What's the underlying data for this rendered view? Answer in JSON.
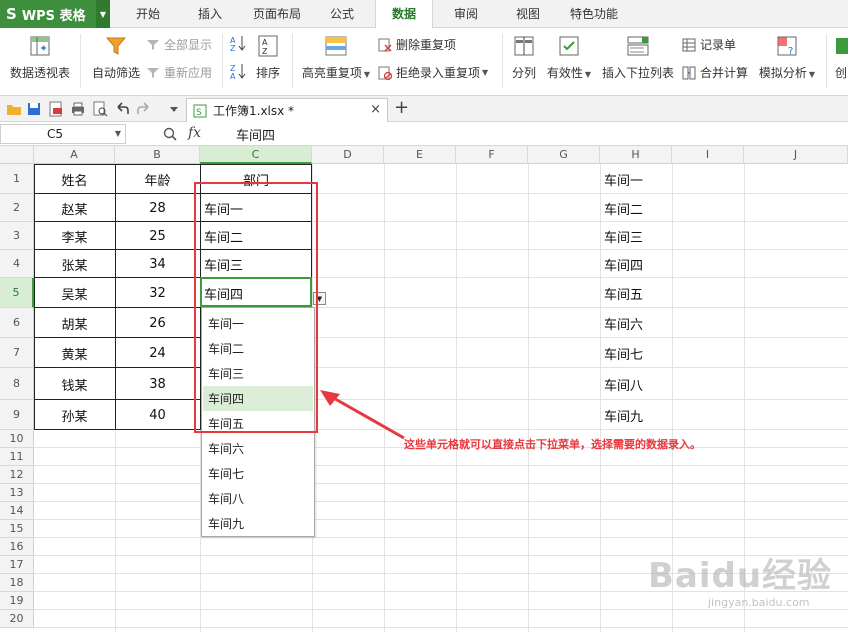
{
  "app": {
    "logo": "S",
    "name": "WPS 表格"
  },
  "tabs": [
    "开始",
    "插入",
    "页面布局",
    "公式",
    "数据",
    "审阅",
    "视图",
    "特色功能"
  ],
  "active_tab": "数据",
  "ribbon": {
    "pivot": "数据透视表",
    "autofilter": "自动筛选",
    "show_all": "全部显示",
    "reapply": "重新应用",
    "sort": "排序",
    "highlight_dup": "高亮重复项",
    "remove_dup": "删除重复项",
    "reject_dup": "拒绝录入重复项",
    "split": "分列",
    "validity": "有效性",
    "insert_dropdown": "插入下拉列表",
    "record": "记录单",
    "merge_calc": "合并计算",
    "simulate": "模拟分析",
    "create": "创"
  },
  "doc": {
    "tab_label": "工作簿1.xlsx *",
    "close": "×",
    "new_tab": "+"
  },
  "formula_bar": {
    "name_box": "C5",
    "fx": "fx",
    "value": "车间四"
  },
  "sheet": {
    "columns": [
      "A",
      "B",
      "C",
      "D",
      "E",
      "F",
      "G",
      "H",
      "I",
      "J"
    ],
    "rows": [
      "1",
      "2",
      "3",
      "4",
      "5",
      "6",
      "7",
      "8",
      "9",
      "10",
      "11",
      "12",
      "13",
      "14",
      "15",
      "16",
      "17",
      "18",
      "19",
      "20"
    ],
    "selected_column": "C",
    "selected_row": "5",
    "header_row": {
      "name": "姓名",
      "age": "年龄",
      "dept": "部门"
    },
    "records": [
      {
        "name": "赵某",
        "age": "28",
        "dept": "车间一"
      },
      {
        "name": "李某",
        "age": "25",
        "dept": "车间二"
      },
      {
        "name": "张某",
        "age": "34",
        "dept": "车间三"
      },
      {
        "name": "吴某",
        "age": "32",
        "dept": "车间四"
      },
      {
        "name": "胡某",
        "age": "26",
        "dept": ""
      },
      {
        "name": "黄某",
        "age": "24",
        "dept": ""
      },
      {
        "name": "钱某",
        "age": "38",
        "dept": ""
      },
      {
        "name": "孙某",
        "age": "40",
        "dept": ""
      }
    ],
    "h_column": [
      "车间一",
      "车间二",
      "车间三",
      "车间四",
      "车间五",
      "车间六",
      "车间七",
      "车间八",
      "车间九"
    ]
  },
  "dropdown": {
    "options": [
      "车间一",
      "车间二",
      "车间三",
      "车间四",
      "车间五",
      "车间六",
      "车间七",
      "车间八",
      "车间九"
    ],
    "highlighted": "车间四"
  },
  "annotation": "这些单元格就可以直接点击下拉菜单，选择需要的数据录入。",
  "watermark": {
    "brand": "Baidu经验",
    "url": "jingyan.baidu.com"
  },
  "colors": {
    "accent": "#3c9a3c",
    "app_green": "#3d8f3d",
    "annotation_red": "#e8383d",
    "highlight": "#dcedd7"
  }
}
